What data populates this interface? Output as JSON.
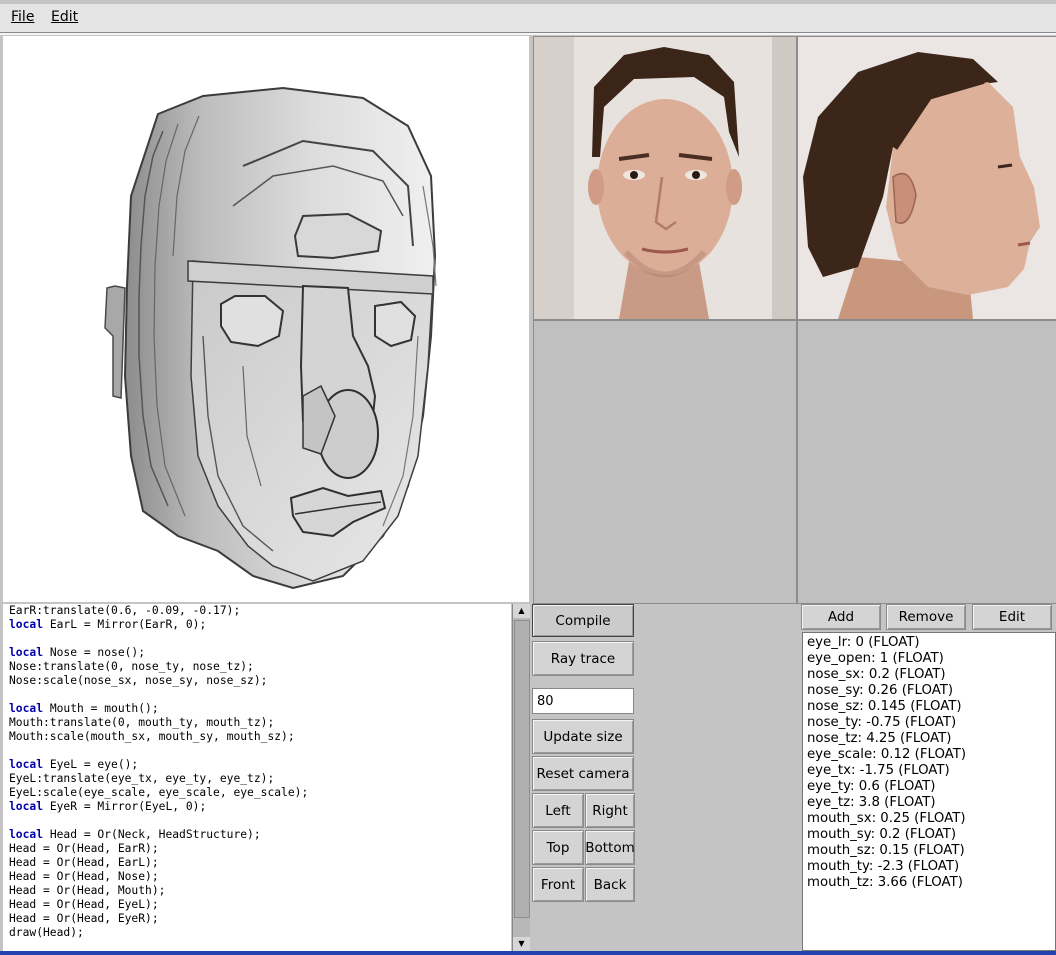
{
  "menu": {
    "file": "File",
    "edit": "Edit"
  },
  "code_lines": [
    "EarR:translate(0.6, -0.09, -0.17);",
    "local EarL = Mirror(EarR, 0);",
    "",
    "local Nose = nose();",
    "Nose:translate(0, nose_ty, nose_tz);",
    "Nose:scale(nose_sx, nose_sy, nose_sz);",
    "",
    "local Mouth = mouth();",
    "Mouth:translate(0, mouth_ty, mouth_tz);",
    "Mouth:scale(mouth_sx, mouth_sy, mouth_sz);",
    "",
    "local EyeL = eye();",
    "EyeL:translate(eye_tx, eye_ty, eye_tz);",
    "EyeL:scale(eye_scale, eye_scale, eye_scale);",
    "local EyeR = Mirror(EyeL, 0);",
    "",
    "local Head = Or(Neck, HeadStructure);",
    "Head = Or(Head, EarR);",
    "Head = Or(Head, EarL);",
    "Head = Or(Head, Nose);",
    "Head = Or(Head, Mouth);",
    "Head = Or(Head, EyeL);",
    "Head = Or(Head, EyeR);",
    "draw(Head);"
  ],
  "controls": {
    "compile": "Compile",
    "ray_trace": "Ray trace",
    "size_value": "80",
    "update_size": "Update size",
    "reset_camera": "Reset camera",
    "left": "Left",
    "right": "Right",
    "top": "Top",
    "bottom": "Bottom",
    "front": "Front",
    "back": "Back"
  },
  "params_toolbar": {
    "add": "Add",
    "remove": "Remove",
    "edit": "Edit"
  },
  "params": [
    "eye_lr: 0 (FLOAT)",
    "eye_open: 1 (FLOAT)",
    "nose_sx: 0.2 (FLOAT)",
    "nose_sy: 0.26 (FLOAT)",
    "nose_sz: 0.145 (FLOAT)",
    "nose_ty: -0.75 (FLOAT)",
    "nose_tz: 4.25 (FLOAT)",
    "eye_scale: 0.12 (FLOAT)",
    "eye_tx: -1.75 (FLOAT)",
    "eye_ty: 0.6 (FLOAT)",
    "eye_tz: 3.8 (FLOAT)",
    "mouth_sx: 0.25 (FLOAT)",
    "mouth_sy: 0.2 (FLOAT)",
    "mouth_sz: 0.15 (FLOAT)",
    "mouth_ty: -2.3 (FLOAT)",
    "mouth_tz: 3.66 (FLOAT)"
  ]
}
